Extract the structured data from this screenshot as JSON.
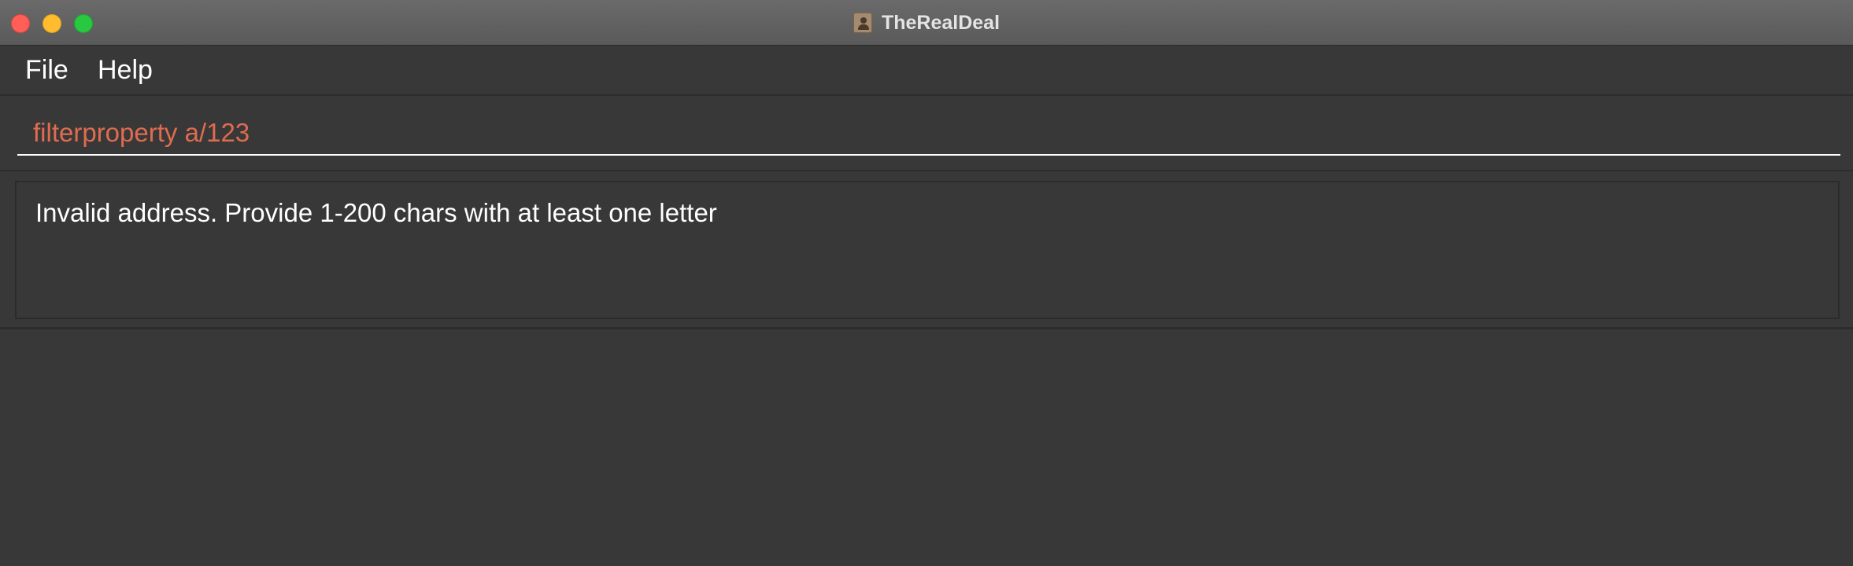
{
  "window": {
    "title": "TheRealDeal",
    "app_icon": "contact-book-icon"
  },
  "menubar": {
    "items": [
      {
        "label": "File"
      },
      {
        "label": "Help"
      }
    ]
  },
  "command_box": {
    "value": "filterproperty a/123",
    "text_color": "#e06c4f"
  },
  "result_display": {
    "message": "Invalid address. Provide 1-200 chars with at least one letter"
  },
  "colors": {
    "background": "#383838",
    "titlebar": "#5f5f5f",
    "close": "#ff5f57",
    "minimize": "#febc2e",
    "zoom": "#28c840"
  }
}
